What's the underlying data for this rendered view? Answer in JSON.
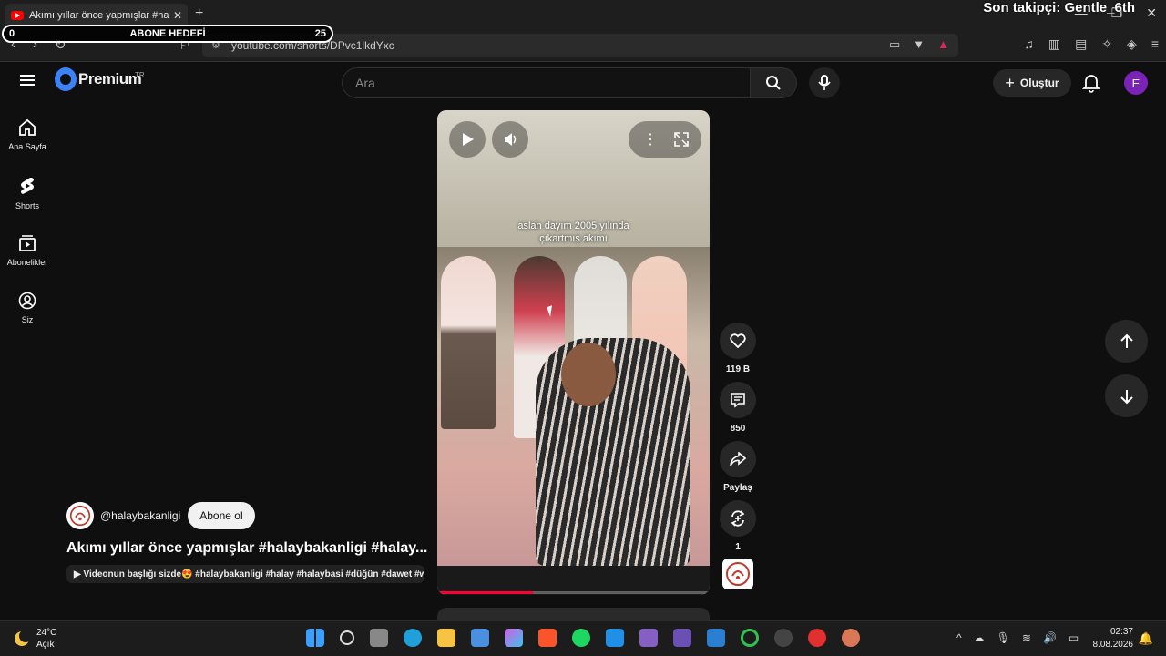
{
  "browser": {
    "tab_title": "Akımı yıllar önce yapmışlar #halay",
    "url": "youtube.com/shorts/DPvc1lkdYxc"
  },
  "overlay": {
    "follower_text": "Son takipçi: Gentle_6th",
    "goal_title": "ABONE HEDEFİ",
    "goal_current": "0",
    "goal_target": "25"
  },
  "header": {
    "logo_text": "Premium",
    "country_code": "TR",
    "search_placeholder": "Ara",
    "create_label": "Oluştur",
    "avatar_letter": "E"
  },
  "sidebar": {
    "items": [
      {
        "label": "Ana Sayfa",
        "icon": "home-icon"
      },
      {
        "label": "Shorts",
        "icon": "shorts-icon"
      },
      {
        "label": "Abonelikler",
        "icon": "subscriptions-icon"
      },
      {
        "label": "Siz",
        "icon": "you-icon"
      }
    ]
  },
  "video": {
    "caption_line1": "aslan dayım 2005 yılında",
    "caption_line2": "çıkartmış akımı",
    "progress": 0.35
  },
  "actions": {
    "likes": "119 B",
    "comments": "850",
    "share_label": "Paylaş",
    "remix_count": "1"
  },
  "channel": {
    "handle": "@halaybakanligi",
    "subscribe_label": "Abone ol",
    "video_title": "Akımı yıllar önce yapmışlar #halaybakanligi #halay...",
    "description": "▶ Videonun başlığı sizde😍 #halaybakanligi #halay #halaybasi #düğün #dawet #w..."
  },
  "taskbar": {
    "temperature": "24°C",
    "weather_desc": "Açık",
    "time": "02:37",
    "date": "8.08.2026"
  },
  "colors": {
    "accent": "#ff0033",
    "avatar": "#7b22b9",
    "background": "#0f0f0f"
  }
}
